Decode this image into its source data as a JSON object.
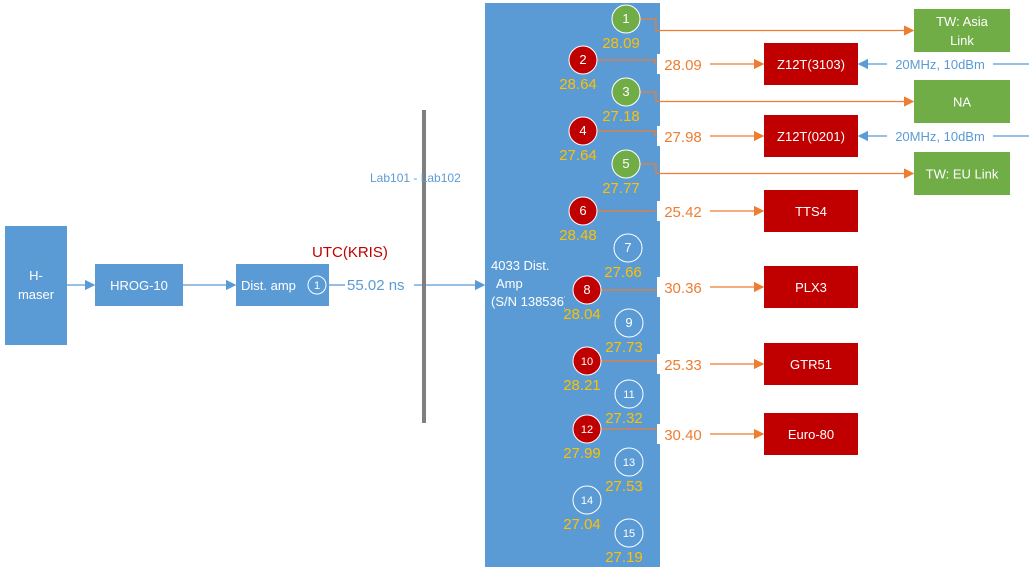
{
  "colors": {
    "blue": "#5b9bd5",
    "green": "#70ad47",
    "red": "#c00000",
    "orange": "#ed7d31",
    "yellow": "#ffc000",
    "gray": "#7f7f7f"
  },
  "chain": {
    "maser": [
      "H-",
      "maser"
    ],
    "hrog": "HROG-10",
    "dist_amp": "Dist. amp",
    "dist_amp_port": "1",
    "utc_label": "UTC(KRIS)",
    "cable_delay": "55.02 ns",
    "lab_label": "Lab101 - Lab102"
  },
  "main_amp": {
    "lines": [
      "4033 Dist.",
      "Amp",
      "(S/N 138536)"
    ]
  },
  "ports": [
    {
      "n": "1",
      "value": "28.09",
      "status": "green"
    },
    {
      "n": "2",
      "value": "28.64",
      "status": "red"
    },
    {
      "n": "3",
      "value": "27.18",
      "status": "green"
    },
    {
      "n": "4",
      "value": "27.64",
      "status": "red"
    },
    {
      "n": "5",
      "value": "27.77",
      "status": "green"
    },
    {
      "n": "6",
      "value": "28.48",
      "status": "red"
    },
    {
      "n": "7",
      "value": "27.66",
      "status": "unused"
    },
    {
      "n": "8",
      "value": "28.04",
      "status": "red"
    },
    {
      "n": "9",
      "value": "27.73",
      "status": "unused"
    },
    {
      "n": "10",
      "value": "28.21",
      "status": "red"
    },
    {
      "n": "11",
      "value": "27.32",
      "status": "unused"
    },
    {
      "n": "12",
      "value": "27.99",
      "status": "red"
    },
    {
      "n": "13",
      "value": "27.53",
      "status": "unused"
    },
    {
      "n": "14",
      "value": "27.04",
      "status": "unused"
    },
    {
      "n": "15",
      "value": "27.19",
      "status": "unused"
    }
  ],
  "targets": [
    {
      "port": "1",
      "label": [
        "TW: Asia",
        "Link"
      ],
      "color": "green",
      "cable": ""
    },
    {
      "port": "2",
      "label": [
        "Z12T(3103)"
      ],
      "color": "red",
      "cable": "28.09",
      "input": "20MHz, 10dBm"
    },
    {
      "port": "3",
      "label": [
        "NA"
      ],
      "color": "green",
      "cable": ""
    },
    {
      "port": "4",
      "label": [
        "Z12T(0201)"
      ],
      "color": "red",
      "cable": "27.98",
      "input": "20MHz, 10dBm"
    },
    {
      "port": "5",
      "label": [
        "TW: EU Link"
      ],
      "color": "green",
      "cable": ""
    },
    {
      "port": "6",
      "label": [
        "TTS4"
      ],
      "color": "red",
      "cable": "25.42"
    },
    {
      "port": "8",
      "label": [
        "PLX3"
      ],
      "color": "red",
      "cable": "30.36"
    },
    {
      "port": "10",
      "label": [
        "GTR51"
      ],
      "color": "red",
      "cable": "25.33"
    },
    {
      "port": "12",
      "label": [
        "Euro-80"
      ],
      "color": "red",
      "cable": "30.40"
    }
  ]
}
